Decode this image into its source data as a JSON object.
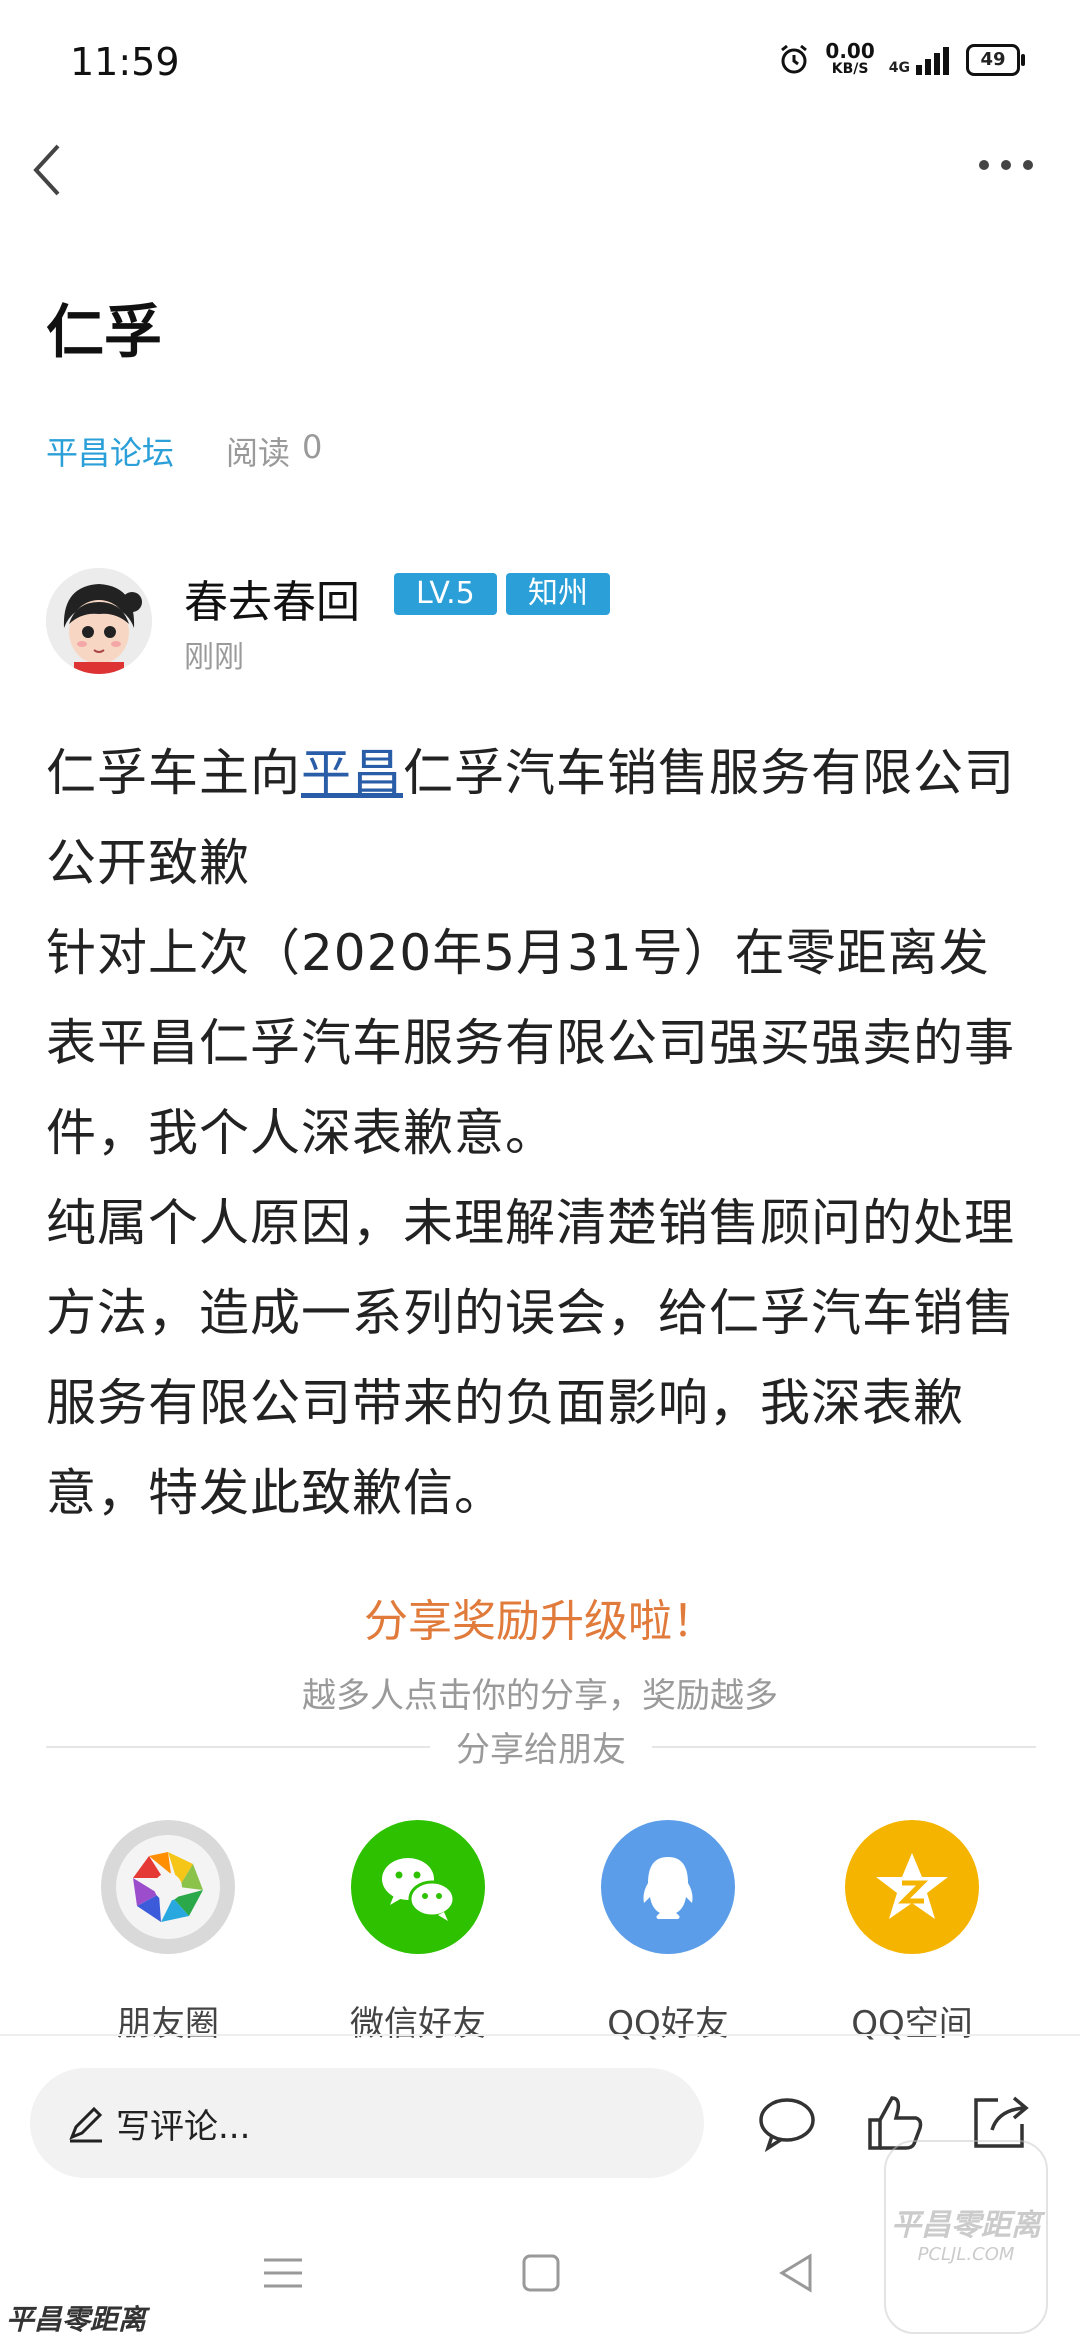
{
  "status_bar": {
    "time": "11:59",
    "speed_value": "0.00",
    "speed_unit": "KB/S",
    "network": "4G",
    "battery": "49"
  },
  "header": {
    "back_icon": "chevron-left-icon",
    "more_icon": "more-horizontal-icon"
  },
  "post": {
    "title": "仁孚",
    "forum": "平昌论坛",
    "reads_label": "阅读",
    "reads_count": "0",
    "author": {
      "name": "春去春回",
      "level": "LV.5",
      "rank": "知州",
      "time": "刚刚"
    },
    "body": {
      "line1_prefix": "仁孚车主向",
      "line1_link": "平昌",
      "line1_suffix": "仁孚汽车销售服务有限公司公开致歉",
      "para2": "针对上次（2020年5月31号）在零距离发表平昌仁孚汽车服务有限公司强买强卖的事件，我个人深表歉意。",
      "para3": "纯属个人原因，未理解清楚销售顾问的处理方法，造成一系列的误会，给仁孚汽车销售服务有限公司带来的负面影响，我深表歉意，特发此致歉信。"
    }
  },
  "share": {
    "title": "分享奖励升级啦！",
    "subtitle": "越多人点击你的分享，奖励越多",
    "divider_text": "分享给朋友",
    "targets": [
      {
        "label": "朋友圈",
        "icon": "moments-icon",
        "color": "#d9d9d9"
      },
      {
        "label": "微信好友",
        "icon": "wechat-icon",
        "color": "#2dc100"
      },
      {
        "label": "QQ好友",
        "icon": "qq-icon",
        "color": "#5b9de8"
      },
      {
        "label": "QQ空间",
        "icon": "qzone-icon",
        "color": "#f5b400"
      }
    ]
  },
  "bottom_bar": {
    "comment_placeholder": "写评论..."
  },
  "watermark": {
    "bottom_left": "平昌零距离",
    "bottom_right": "平昌零距离",
    "bottom_right_domain": "PCLJL.COM"
  },
  "colors": {
    "accent": "#2a9fd8",
    "share_title": "#e07b3c",
    "link": "#2a5da8"
  }
}
